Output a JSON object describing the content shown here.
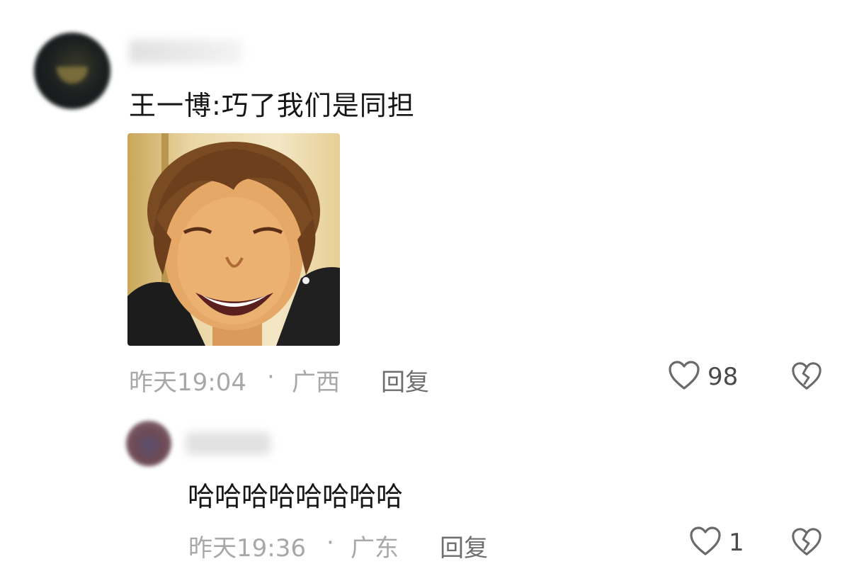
{
  "comments": [
    {
      "text": "王一博:巧了我们是同担",
      "time": "昨天19:04",
      "separator": "·",
      "location": "广西",
      "reply_label": "回复",
      "likes": "98"
    }
  ],
  "replies": [
    {
      "text": "哈哈哈哈哈哈哈哈",
      "time": "昨天19:36",
      "separator": "·",
      "location": "广东",
      "reply_label": "回复",
      "likes": "1"
    }
  ],
  "icons": {
    "like": "heart-outline-icon",
    "dislike": "broken-heart-icon"
  }
}
